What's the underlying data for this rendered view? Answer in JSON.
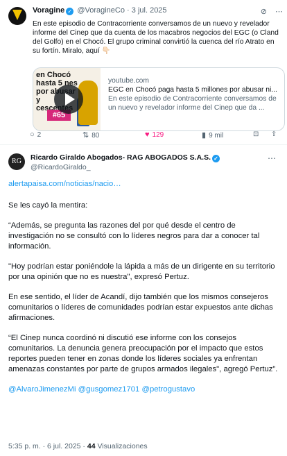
{
  "quoted_tweet": {
    "author_name": "Voragine",
    "handle": "@VoragineCo",
    "date": "3 jul. 2025",
    "text": "En este episodio de Contracorriente conversamos de un nuevo y revelador informe del Cinep que da cuenta de los macabros negocios del EGC (o Cland del Golfo) en el Chocó. El grupo criminal convirtió la cuenca del río Atrato en su fortín. Miralo, aquí 👇🏻",
    "icons": [
      "grok-icon",
      "more-icon"
    ],
    "card": {
      "thumb_text": "en Chocó hasta 5 nes por abusar y cescentes",
      "thumb_tag": "#65",
      "domain": "youtube.com",
      "title": "EGC en Chocó paga hasta 5 millones por abusar ni...",
      "description": "En este episodio de Contracorriente conversamos de un nuevo y revelador informe del Cinep que da ..."
    },
    "actions": {
      "replies": "2",
      "retweets": "80",
      "likes": "129",
      "views": "9 mil"
    },
    "like_color": "#f91880"
  },
  "main_tweet": {
    "avatar_text": "RG",
    "author_name": "Ricardo Giraldo Abogados- RAG ABOGADOS S.A.S.",
    "handle": "@RicardoGiraldo_",
    "link": "alertapaisa.com/noticias/nacio",
    "paragraphs": [
      "Se les cayó la mentira:",
      "“Además, se pregunta las razones del por qué desde el centro de investigación no se consultó con lo líderes negros para dar a conocer tal información.",
      "\"Hoy podrían estar poniéndole la lápida a más de un dirigente en su territorio por una opinión que no es nuestra\", expresó Pertuz.",
      "En ese sentido, el líder de Acandí, dijo también que los mismos consejeros comunitarios o líderes de comunidades podrían estar expuestos ante dichas afirmaciones.",
      "“El Cinep nunca coordinó ni discutió ese informe con los consejos comunitarios.  La denuncia genera preocupación por el impacto que estos reportes pueden tener en zonas donde los líderes sociales ya enfrentan amenazas constantes por parte de grupos armados ilegales\", agregó Pertuz”."
    ],
    "mentions": "@AlvaroJimenezMi @gusgomez1701 @petrogustavo",
    "time": "5:35 p. m.",
    "date": "6 jul. 2025",
    "views_count": "44",
    "views_label": "Visualizaciones",
    "accent_color": "#1d9bf0"
  }
}
